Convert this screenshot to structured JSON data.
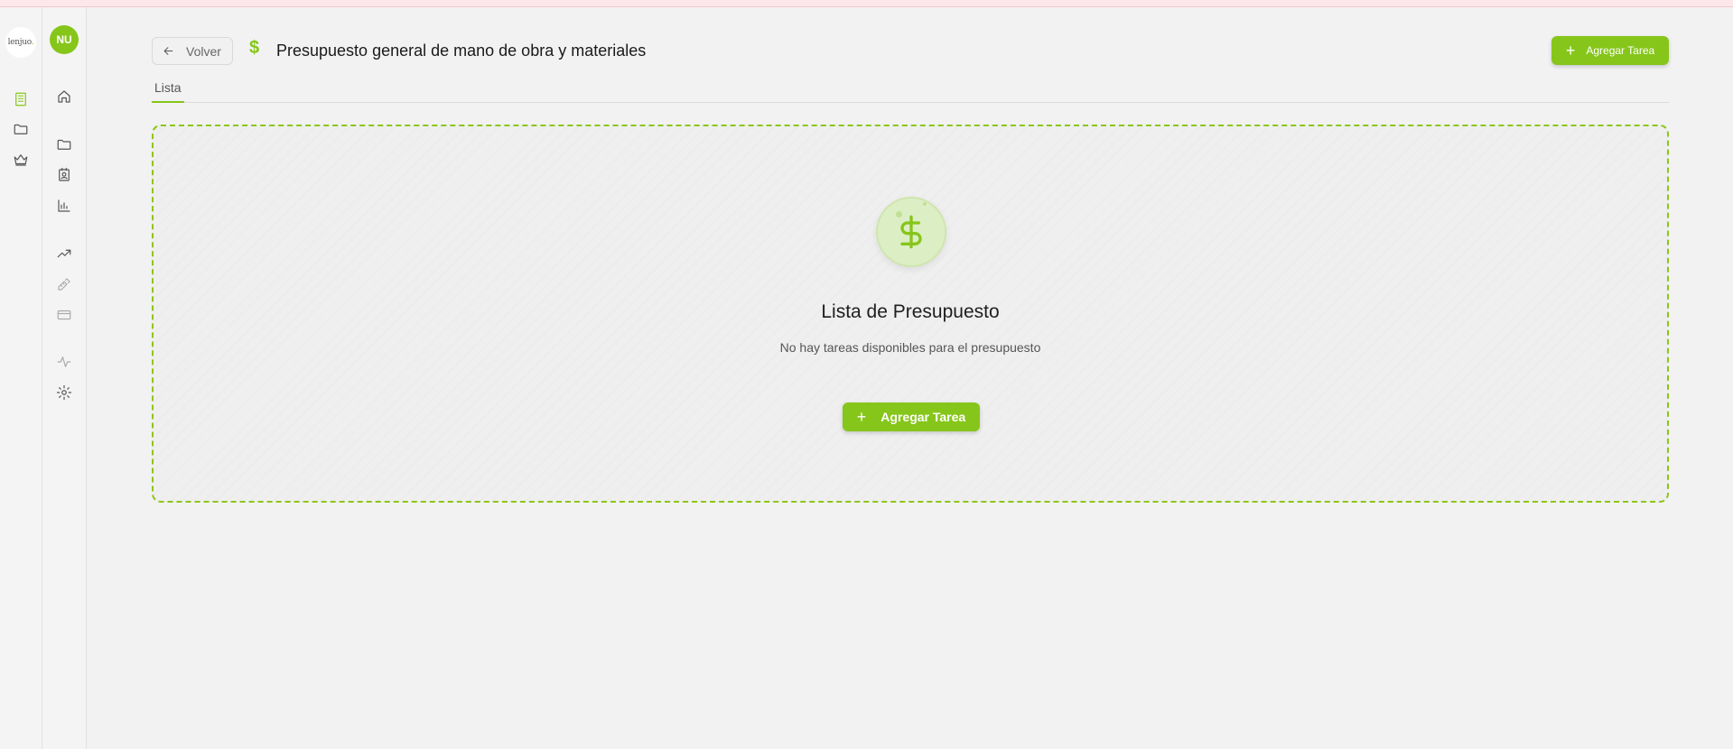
{
  "brand": {
    "logo_text": "lenjuo",
    "logo_dot": "."
  },
  "user": {
    "initials": "NU"
  },
  "rail1": {
    "icons": [
      "building-icon",
      "folder-icon",
      "crown-icon"
    ]
  },
  "rail2": {
    "icons": [
      "home-icon",
      "folder-icon",
      "contact-icon",
      "bar-chart-icon",
      "trending-up-icon",
      "ruler-pencil-icon",
      "credit-card-icon",
      "activity-icon",
      "gear-icon"
    ]
  },
  "header": {
    "back_label": "Volver",
    "title_symbol": "$",
    "title": "Presupuesto general de mano de obra y materiales",
    "add_button_label": "Agregar Tarea",
    "add_icon": "+"
  },
  "tabs": [
    {
      "label": "Lista",
      "active": true
    }
  ],
  "empty_state": {
    "icon_symbol": "$",
    "title": "Lista de Presupuesto",
    "subtitle": "No hay tareas disponibles para el presupuesto",
    "add_button_label": "Agregar Tarea",
    "add_icon": "+"
  },
  "colors": {
    "accent": "#86c61a",
    "background": "#f2f2f2"
  }
}
